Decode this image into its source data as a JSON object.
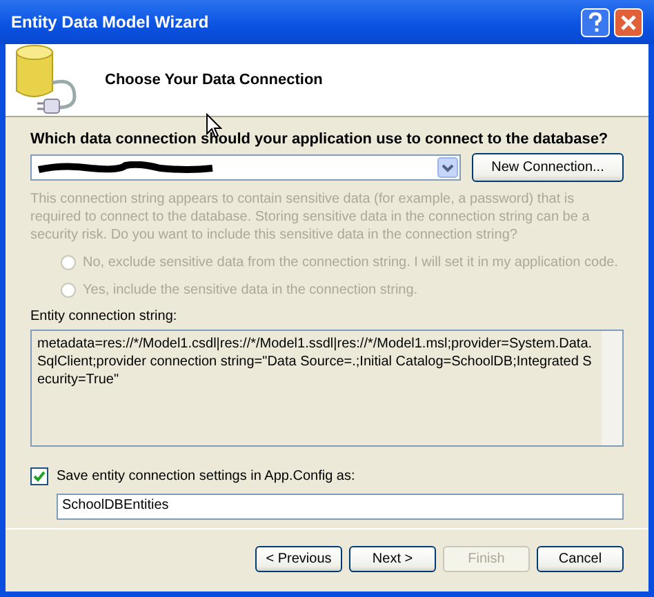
{
  "window": {
    "title": "Entity Data Model Wizard"
  },
  "header": {
    "title": "Choose Your Data Connection"
  },
  "question": "Which data connection should your application use to connect to the database?",
  "connection": {
    "redacted": true
  },
  "new_connection_button": "New Connection...",
  "sensitive": {
    "text": "This connection string appears to contain sensitive data (for example, a password) that is required to connect to the database. Storing sensitive data in the connection string can be a security risk. Do you want to include this sensitive data in the connection string?",
    "disabled": true,
    "options": [
      {
        "label": "No, exclude sensitive data from the connection string. I will set it in my application code.",
        "selected": false,
        "disabled": true
      },
      {
        "label": "Yes, include the sensitive data in the connection string.",
        "selected": false,
        "disabled": true
      }
    ]
  },
  "entity_string": {
    "label": "Entity connection string:",
    "value": "metadata=res://*/Model1.csdl|res://*/Model1.ssdl|res://*/Model1.msl;provider=System.Data.SqlClient;provider connection string=\"Data Source=.;Initial Catalog=SchoolDB;Integrated Security=True\""
  },
  "save_settings": {
    "label": "Save entity connection settings in App.Config as:",
    "checked": true,
    "value": "SchoolDBEntities"
  },
  "buttons": [
    {
      "label": "< Previous",
      "disabled": false
    },
    {
      "label": "Next >",
      "disabled": false
    },
    {
      "label": "Finish",
      "disabled": true
    },
    {
      "label": "Cancel",
      "disabled": false
    }
  ]
}
